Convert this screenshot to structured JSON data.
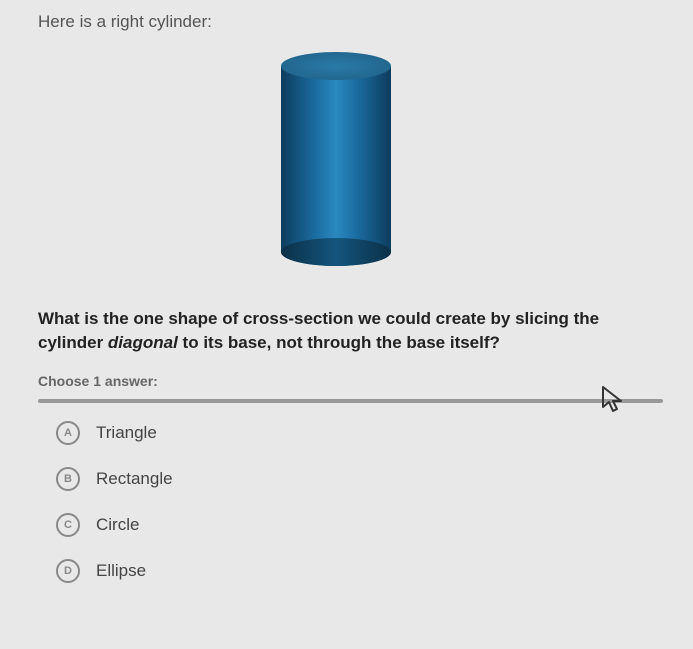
{
  "intro_text": "Here is a right cylinder:",
  "question_before": "What is the one shape of cross-section we could create by slicing the cylinder ",
  "question_em": "diagonal",
  "question_after": " to its base, not through the base itself?",
  "choose_label": "Choose 1 answer:",
  "options": [
    {
      "letter": "A",
      "label": "Triangle"
    },
    {
      "letter": "B",
      "label": "Rectangle"
    },
    {
      "letter": "C",
      "label": "Circle"
    },
    {
      "letter": "D",
      "label": "Ellipse"
    }
  ]
}
